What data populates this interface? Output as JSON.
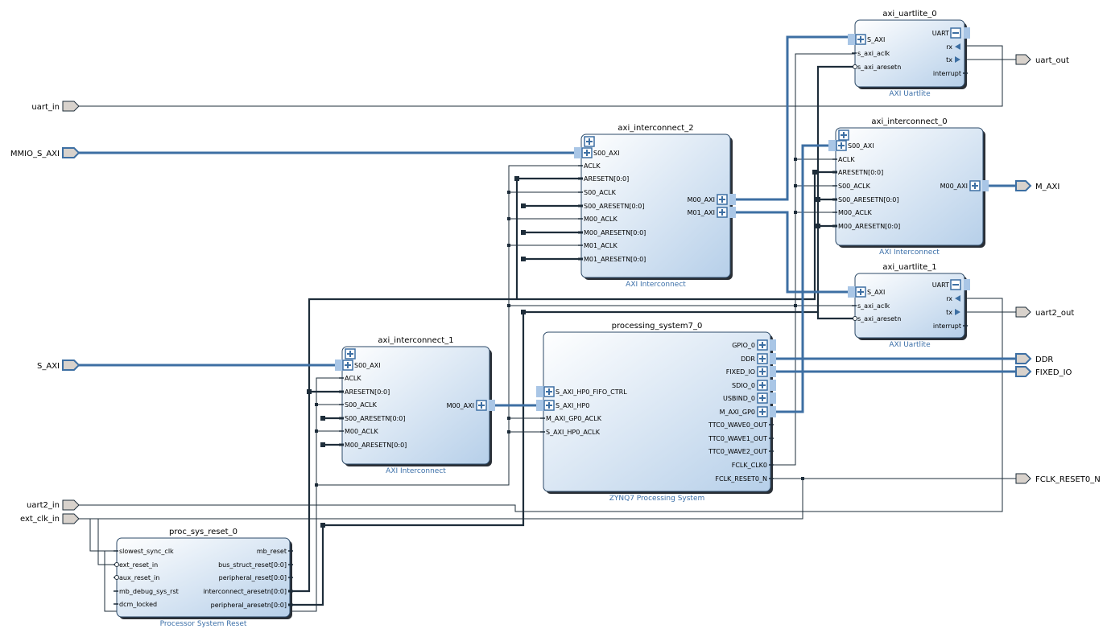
{
  "colors": {
    "bus": "#3d6fa3",
    "wire": "#1e2d3a",
    "block_fill_top": "#ffffff",
    "block_fill_bottom": "#b9d1ea",
    "block_border": "#2c4a68",
    "subtitle": "#3b6fa8",
    "port_fill": "#d8d2cc"
  },
  "external_ports": {
    "uart_in": "uart_in",
    "mmio_s_axi": "MMIO_S_AXI",
    "s_axi": "S_AXI",
    "uart2_in": "uart2_in",
    "ext_clk_in": "ext_clk_in",
    "uart_out": "uart_out",
    "m_axi": "M_AXI",
    "uart2_out": "uart2_out",
    "ddr": "DDR",
    "fixed_io": "FIXED_IO",
    "fclk_reset0_n": "FCLK_RESET0_N"
  },
  "blocks": {
    "axi_uartlite_0": {
      "title": "axi_uartlite_0",
      "subtitle": "AXI Uartlite",
      "in_pins": [
        "S_AXI",
        "s_axi_aclk",
        "s_axi_aresetn"
      ],
      "out_pins": [
        "UART",
        "rx",
        "tx",
        "interrupt"
      ]
    },
    "axi_interconnect_0": {
      "title": "axi_interconnect_0",
      "subtitle": "AXI Interconnect",
      "in_pins": [
        "S00_AXI",
        "ACLK",
        "ARESETN[0:0]",
        "S00_ACLK",
        "S00_ARESETN[0:0]",
        "M00_ACLK",
        "M00_ARESETN[0:0]"
      ],
      "out_pins": [
        "M00_AXI"
      ]
    },
    "axi_interconnect_2": {
      "title": "axi_interconnect_2",
      "subtitle": "AXI Interconnect",
      "in_pins": [
        "S00_AXI",
        "ACLK",
        "ARESETN[0:0]",
        "S00_ACLK",
        "S00_ARESETN[0:0]",
        "M00_ACLK",
        "M00_ARESETN[0:0]",
        "M01_ACLK",
        "M01_ARESETN[0:0]"
      ],
      "out_pins": [
        "M00_AXI",
        "M01_AXI"
      ]
    },
    "axi_uartlite_1": {
      "title": "axi_uartlite_1",
      "subtitle": "AXI Uartlite",
      "in_pins": [
        "S_AXI",
        "s_axi_aclk",
        "s_axi_aresetn"
      ],
      "out_pins": [
        "UART",
        "rx",
        "tx",
        "interrupt"
      ]
    },
    "axi_interconnect_1": {
      "title": "axi_interconnect_1",
      "subtitle": "AXI Interconnect",
      "in_pins": [
        "S00_AXI",
        "ACLK",
        "ARESETN[0:0]",
        "S00_ACLK",
        "S00_ARESETN[0:0]",
        "M00_ACLK",
        "M00_ARESETN[0:0]"
      ],
      "out_pins": [
        "M00_AXI"
      ]
    },
    "processing_system7_0": {
      "title": "processing_system7_0",
      "subtitle": "ZYNQ7 Processing System",
      "in_pins": [
        "S_AXI_HP0_FIFO_CTRL",
        "S_AXI_HP0",
        "M_AXI_GP0_ACLK",
        "S_AXI_HP0_ACLK"
      ],
      "out_pins": [
        "GPIO_0",
        "DDR",
        "FIXED_IO",
        "SDIO_0",
        "USBIND_0",
        "M_AXI_GP0",
        "TTC0_WAVE0_OUT",
        "TTC0_WAVE1_OUT",
        "TTC0_WAVE2_OUT",
        "FCLK_CLK0",
        "FCLK_RESET0_N"
      ]
    },
    "proc_sys_reset_0": {
      "title": "proc_sys_reset_0",
      "subtitle": "Processor System Reset",
      "in_pins": [
        "slowest_sync_clk",
        "ext_reset_in",
        "aux_reset_in",
        "mb_debug_sys_rst",
        "dcm_locked"
      ],
      "out_pins": [
        "mb_reset",
        "bus_struct_reset[0:0]",
        "peripheral_reset[0:0]",
        "interconnect_aresetn[0:0]",
        "peripheral_aresetn[0:0]"
      ]
    }
  }
}
